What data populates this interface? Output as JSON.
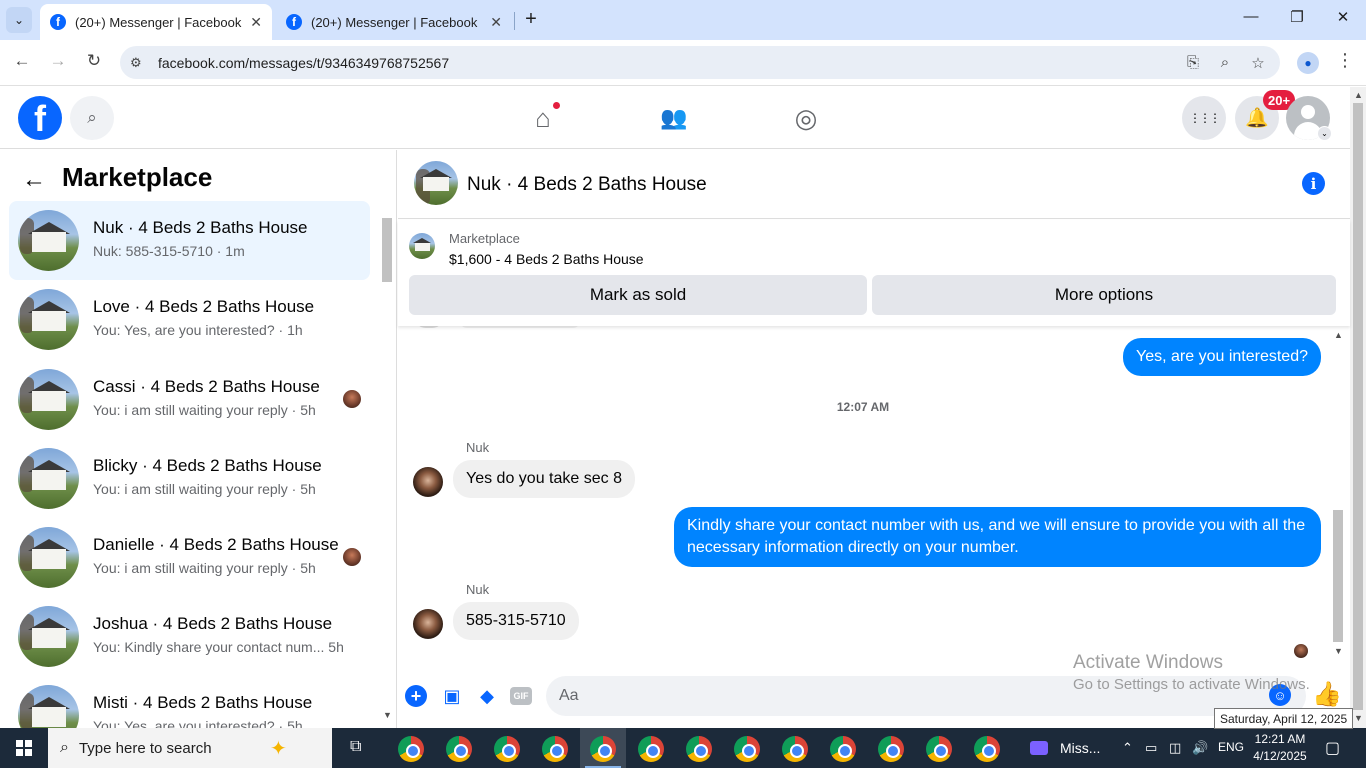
{
  "browser": {
    "tabs": [
      {
        "title": "(20+) Messenger | Facebook",
        "active": true
      },
      {
        "title": "(20+) Messenger | Facebook",
        "active": false
      }
    ],
    "url": "facebook.com/messages/t/9346349768752567",
    "icons": {
      "back": "←",
      "forward": "→",
      "reload": "↻",
      "tune": "⚙",
      "install": "⎘",
      "zoom": "⌕",
      "star": "☆",
      "profile": "●",
      "menu": "⋮",
      "minimize": "—",
      "maximize": "❐",
      "close": "✕",
      "tab_close": "✕",
      "new_tab": "+",
      "tab_search": "⌄"
    }
  },
  "fb_header": {
    "logo": "f",
    "notifications_badge": "20+",
    "icons": {
      "search": "⌕",
      "home": "⌂",
      "friends": "👥",
      "groups": "◎",
      "apps": "⋮⋮⋮",
      "bell": "🔔",
      "chevron": "⌄"
    }
  },
  "left_panel": {
    "back_icon": "←",
    "title": "Marketplace",
    "conversations": [
      {
        "name": "Nuk · 4 Beds 2 Baths House",
        "preview": "Nuk: 585-315-5710 · 1m",
        "selected": true
      },
      {
        "name": "Love · 4 Beds 2 Baths House",
        "preview": "You: Yes, are you interested? · 1h"
      },
      {
        "name": "Cassi · 4 Beds 2 Baths House",
        "preview": "You: i am still waiting your reply · 5h"
      },
      {
        "name": "Blicky · 4 Beds 2 Baths House",
        "preview": "You: i am still waiting your reply · 5h"
      },
      {
        "name": "Danielle · 4 Beds 2 Baths House",
        "preview": "You: i am still waiting your reply · 5h"
      },
      {
        "name": "Joshua · 4 Beds 2 Baths House",
        "preview": "You: Kindly share your contact num... 5h"
      },
      {
        "name": "Misti · 4 Beds 2 Baths House",
        "preview": "You: Yes, are you interested? · 5h"
      }
    ]
  },
  "chat": {
    "title": "Nuk · 4 Beds 2 Baths House",
    "info_icon": "i",
    "marketplace_label": "Marketplace",
    "listing": "$1,600 - 4 Beds 2 Baths House",
    "mark_sold": "Mark as sold",
    "more_options": "More options",
    "messages": {
      "out1": "Yes, are you interested?",
      "time": "12:07 AM",
      "sender1": "Nuk",
      "in1": "Yes do you take sec 8",
      "out2": "Kindly share your contact number with us, and we will ensure to provide you with all the necessary information directly on your number.",
      "sender2": "Nuk",
      "in2": "585-315-5710"
    },
    "composer_placeholder": "Aa",
    "composer_icons": {
      "plus": "+",
      "gallery": "▣",
      "sticker": "◆",
      "gif": "GIF",
      "emoji": "☺",
      "like": "👍"
    }
  },
  "overlay": {
    "activate_title": "Activate Windows",
    "activate_sub": "Go to Settings to activate Windows.",
    "date_tooltip": "Saturday, April 12, 2025"
  },
  "taskbar": {
    "search_placeholder": "Type here to search",
    "app_label": "Miss...",
    "lang": "ENG",
    "time": "12:21 AM",
    "date": "4/12/2025",
    "icons": {
      "search": "⌕",
      "spark": "✦",
      "task_view": "⧉",
      "tray_up": "⌃",
      "battery": "▭",
      "network": "◫",
      "volume": "🔊",
      "notifications": "▢"
    }
  }
}
